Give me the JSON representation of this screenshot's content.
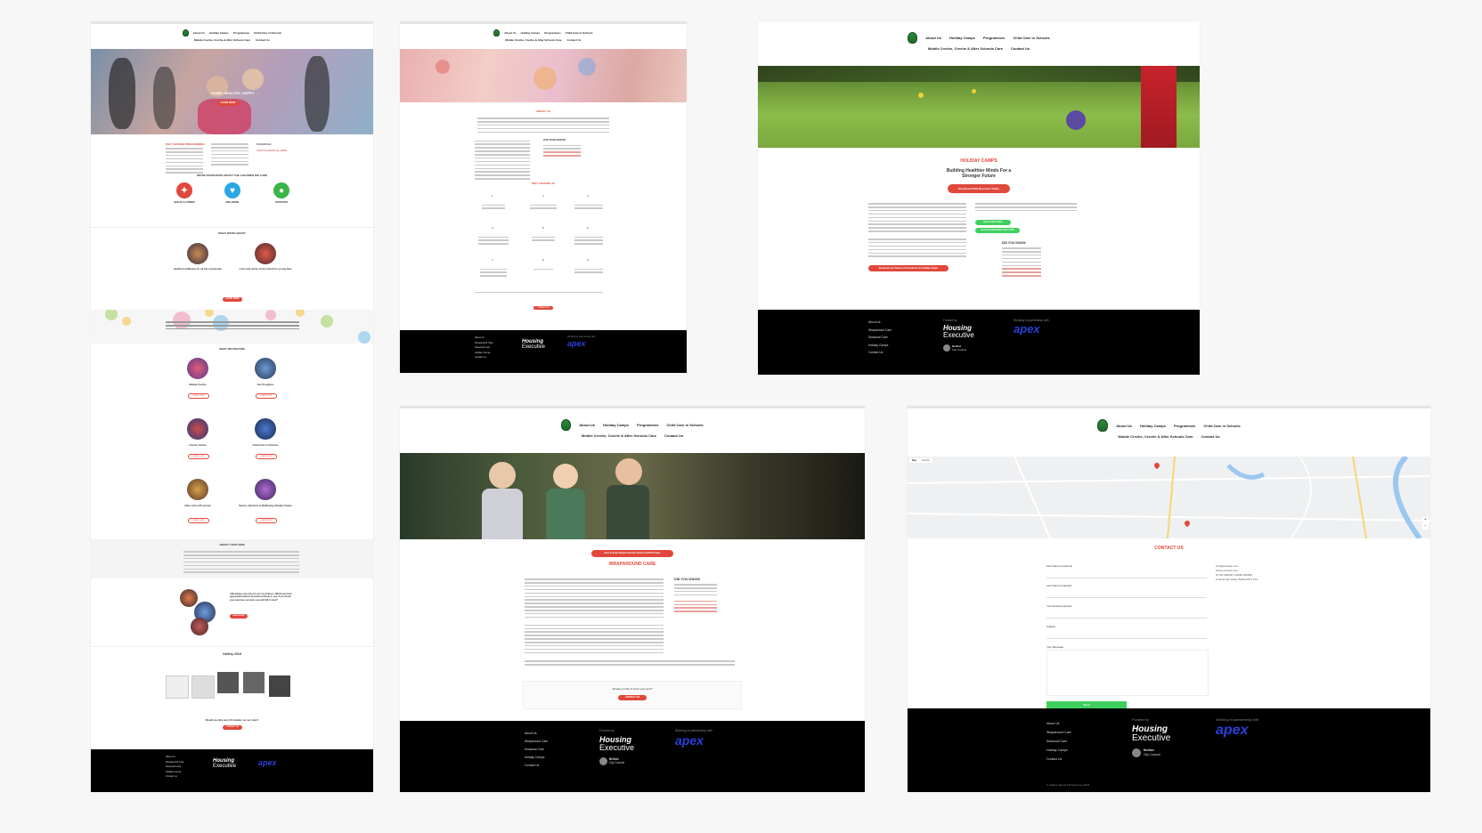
{
  "nav": {
    "about": "About Us",
    "holiday": "Holiday Camps",
    "programmes": "Programmes",
    "childcare": "Child Care in Schools",
    "mobile": "Mobile Creche, Creche & After Schools Care",
    "contact": "Contact Us"
  },
  "home": {
    "hero_title": "HOME, HEALTHY, HAPPY",
    "hero_btn": "LEARN MORE",
    "left_heading": "WHY CHOOSE PROGRAMMES",
    "right_heading": "SCHEDULE",
    "right_link": "VIEW SCHEDULE HERE",
    "values_heading": "WE'RE PASSIONATE ABOUT THE CHILDREN WE CARE",
    "icons": [
      "HEALTH & FITNESS",
      "WELLBEING",
      "NUTRITION"
    ],
    "what_heading": "WHAT WE'RE ABOUT",
    "what_items": [
      "Health & wellbeing for all the community",
      "A fun and active environment for young kids"
    ],
    "what_btn": "LEARN MORE",
    "offer_heading": "WHAT WE PROVIDE",
    "offers": [
      "Mobile Creche",
      "Our Programs",
      "Creche Centre",
      "Child Care in Schools",
      "After-school Provision",
      "Sports, Nutrition & Wellbeing Holiday Camps"
    ],
    "offer_btn": "LEARN MORE",
    "about_heading": "ABOUT YOUR AIMS",
    "testimonial_text": "\"We always can rely on Let's Go Fitness. Which we have appreciated before and will continue to use. If you book your exercise sessions you will fall in love!\"",
    "testimonial_btn": "READ MORE",
    "gallery_heading": "Gallery 2018",
    "cta": "Would you like any information on our sites?",
    "cta_btn": "CONTACT US"
  },
  "about": {
    "heading": "ABOUT US",
    "right_heading": "OUR TEAM CENTRE",
    "why_heading": "WHY CHOOSE US",
    "nums": [
      "1",
      "2",
      "3",
      "4",
      "5",
      "6",
      "7",
      "8",
      "9"
    ],
    "btn": "CONTACT US"
  },
  "holiday": {
    "heading": "HOLIDAY CAMPS",
    "subheading": "Building Healthier Minds For a Stronger Future",
    "red_btn": "Download 2018 Brochure Today",
    "green_btn1": "Book Today Online",
    "green_btn2": "Download Newsletter Sheet 2018",
    "did_you_know": "DID YOU KNOW",
    "bottom_btn": "Download our Policies & Procedures for Holiday Camps"
  },
  "wrap": {
    "pill": "Best Creche Wraparound Kit Award at 2016 Project",
    "heading": "WRAPAROUND CARE",
    "did_you_know": "DID YOU KNOW",
    "cta": "Would you like to book your spot?",
    "cta_btn": "CONTACT US"
  },
  "contact": {
    "heading": "CONTACT US",
    "map_btn1": "Map",
    "map_btn2": "Satellite",
    "labels": [
      "First Name (required)",
      "Last Name (required)",
      "Your Email (required)",
      "Subject",
      "Your Message"
    ],
    "send": "Send",
    "info": [
      "info@example.com",
      "www.example.com",
      "07700 900000 / 02890 000000",
      "10 Example Road, Belfast BT1 1AA"
    ]
  },
  "footer": {
    "links": [
      "About Us",
      "Wraparound Care",
      "Seasonal Care",
      "Holiday Camps",
      "Contact Us"
    ],
    "funded": "Funded by",
    "housing1": "Housing",
    "housing2": "Executive",
    "council1": "Belfast",
    "council2": "City Council",
    "partner": "Working in partnership with",
    "apex": "apex",
    "copyright": "© Holiday Camps & Programmes 2018"
  }
}
